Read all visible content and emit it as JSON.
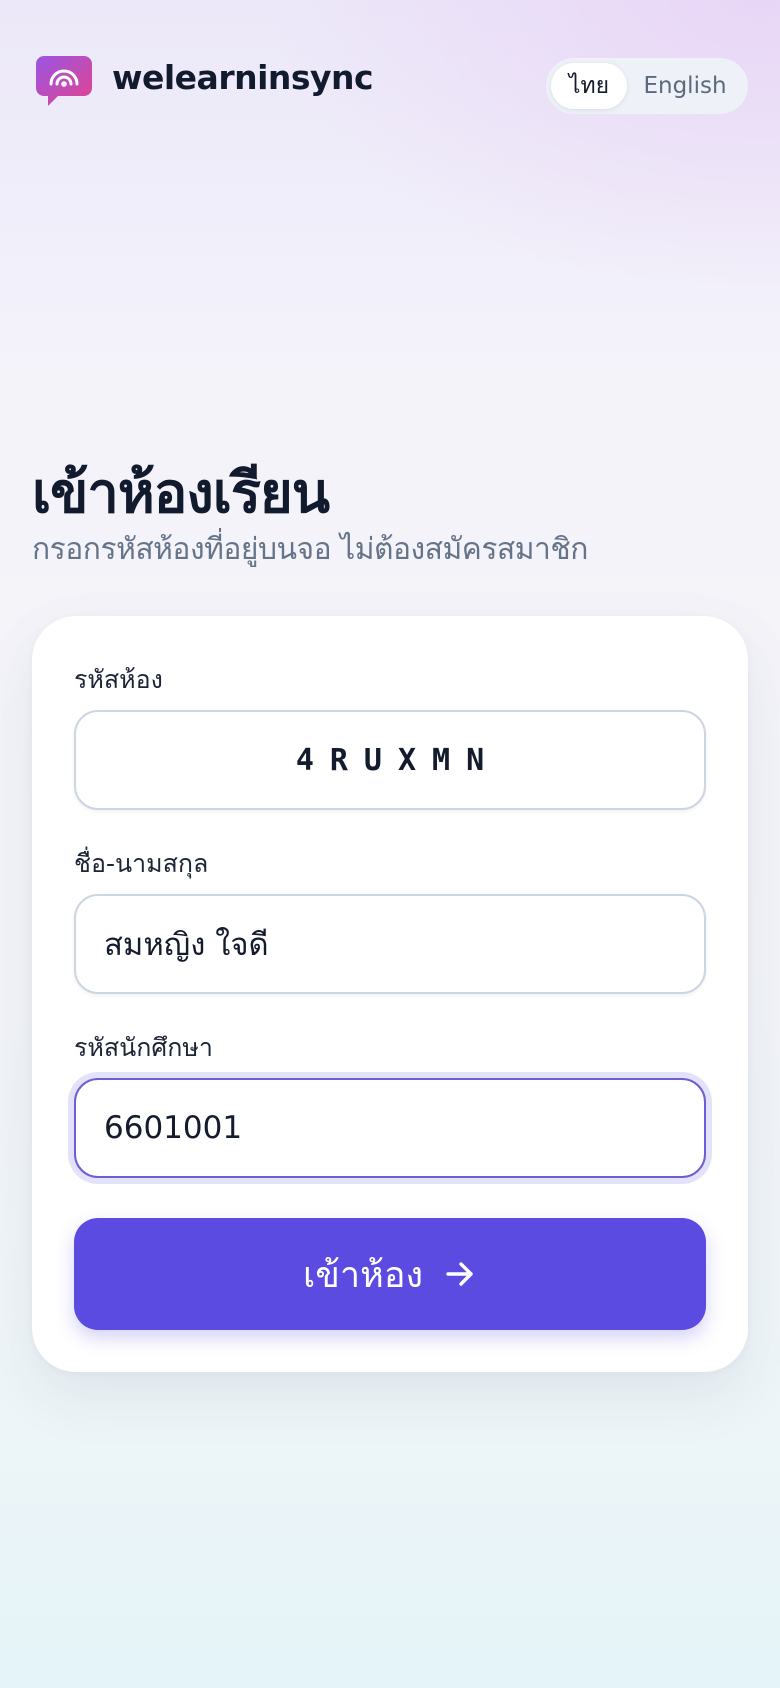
{
  "header": {
    "brand_name": "welearninsync",
    "logo_icon": "broadcast-chat-icon",
    "language_options": [
      {
        "label": "ไทย",
        "selected": true
      },
      {
        "label": "English",
        "selected": false
      }
    ]
  },
  "main": {
    "title": "เข้าห้องเรียน",
    "subtitle": "กรอกรหัสห้องที่อยู่บนจอ ไม่ต้องสมัครสมาชิก"
  },
  "form": {
    "room_code": {
      "label": "รหัสห้อง",
      "value": "4RUXMN"
    },
    "full_name": {
      "label": "ชื่อ-นามสกุล",
      "value": "สมหญิง ใจดี"
    },
    "student_id": {
      "label": "รหัสนักศึกษา",
      "value": "6601001"
    },
    "submit_label": "เข้าห้อง",
    "submit_icon": "arrow-right-icon"
  },
  "colors": {
    "accent": "#5b4be0",
    "logo_gradient_start": "#a64fe0",
    "logo_gradient_end": "#e0458f",
    "title_text": "#121a2e",
    "muted_text": "#66748a"
  }
}
